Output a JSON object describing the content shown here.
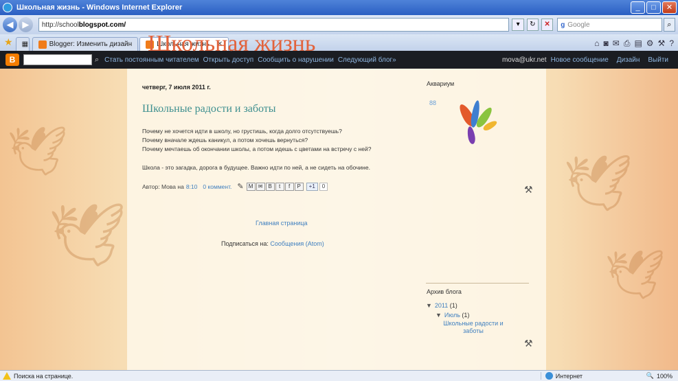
{
  "window": {
    "title": "Школьная жизнь - Windows Internet Explorer"
  },
  "address": {
    "prefix": "http://school",
    "host": "blogspot.com/",
    "search_engine": "Google"
  },
  "tabs": [
    {
      "label": "Blogger: Изменить дизайн"
    },
    {
      "label": "Школьная жизнь"
    }
  ],
  "blogger_bar": {
    "links": [
      "Стать постоянным читателем",
      "Открыть доступ",
      "Сообщить о нарушении",
      "Следующий блог»"
    ],
    "email": "mova@ukr.net",
    "right_links": [
      "Новое сообщение",
      "Дизайн",
      "Выйти"
    ]
  },
  "blog": {
    "title": "Школьная жизнь",
    "post": {
      "date": "четверг, 7 июля 2011 г.",
      "title": "Школьные радости и заботы",
      "lines": [
        "Почему не хочется идти в школу, но грустишь, когда долго отсутствуешь?",
        "Почему вначале ждешь каникул, а потом хочешь вернуться?",
        "Почему мечтаешь об окончании школы, а потом идешь с цветами на встречу с ней?"
      ],
      "summary": "Школа - это загадка, дорога в будущее. Важно идти по ней, а не сидеть на обочине.",
      "author_prefix": "Автор: Мова на",
      "time": "8:10",
      "comments": "0 коммент.",
      "share_buttons": [
        "M",
        "✉",
        "B",
        "t",
        "f",
        "P"
      ],
      "plusone": "+1",
      "plusone_count": "0"
    },
    "home_link": "Главная страница",
    "subscribe_prefix": "Подписаться на:",
    "subscribe_link": "Сообщения (Atom)"
  },
  "sidebar": {
    "aquarium_title": "Аквариум",
    "aquarium_badge": "88",
    "archive_title": "Архив блога",
    "archive": {
      "year": "2011",
      "year_count": "(1)",
      "month": "Июль",
      "month_count": "(1)",
      "post": "Школьные радости и заботы"
    }
  },
  "status": {
    "text": "Поиска на странице.",
    "zone": "Интернет",
    "zoom": "100%"
  }
}
